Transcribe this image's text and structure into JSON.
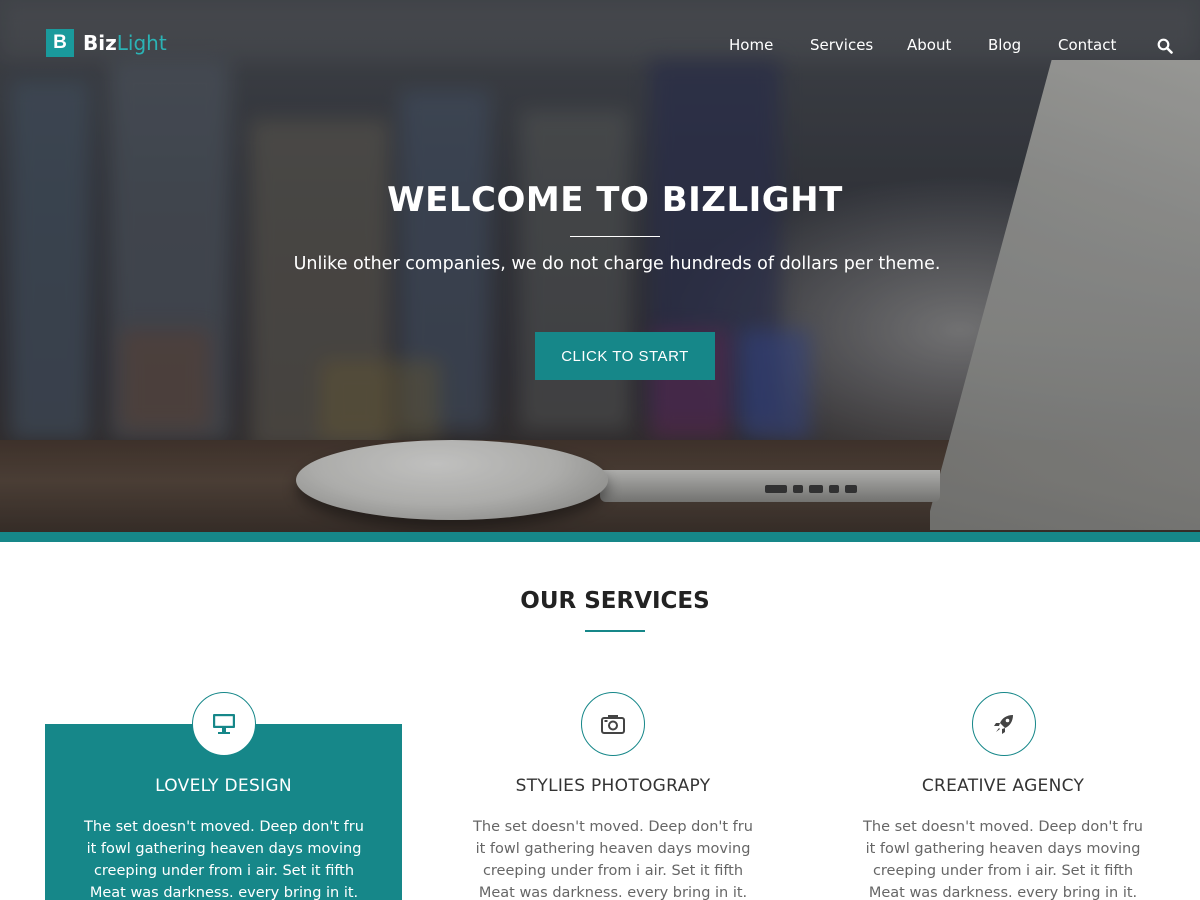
{
  "brand": {
    "badge": "B",
    "name_bold": "Biz",
    "name_light": "Light"
  },
  "nav": {
    "items": [
      "Home",
      "Services",
      "About",
      "Blog",
      "Contact"
    ]
  },
  "hero": {
    "title": "WELCOME TO BIZLIGHT",
    "subtitle": "Unlike other companies, we do not charge hundreds of dollars per theme.",
    "cta_label": "CLICK TO START"
  },
  "services": {
    "title": "OUR SERVICES",
    "items": [
      {
        "title": "LOVELY DESIGN",
        "icon": "monitor-icon",
        "text": "The set doesn't moved. Deep don't fru it fowl gathering heaven days moving creeping under from i air. Set it fifth Meat was darkness. every bring in it."
      },
      {
        "title": "STYLIES PHOTOGRAPY",
        "icon": "camera-icon",
        "text": "The set doesn't moved. Deep don't fru it fowl gathering heaven days moving creeping under from i air. Set it fifth Meat was darkness. every bring in it."
      },
      {
        "title": "CREATIVE AGENCY",
        "icon": "rocket-icon",
        "text": "The set doesn't moved. Deep don't fru it fowl gathering heaven days moving creeping under from i air. Set it fifth Meat was darkness. every bring in it."
      }
    ]
  },
  "colors": {
    "accent": "#168789",
    "logo_light": "#2bb3b5"
  }
}
